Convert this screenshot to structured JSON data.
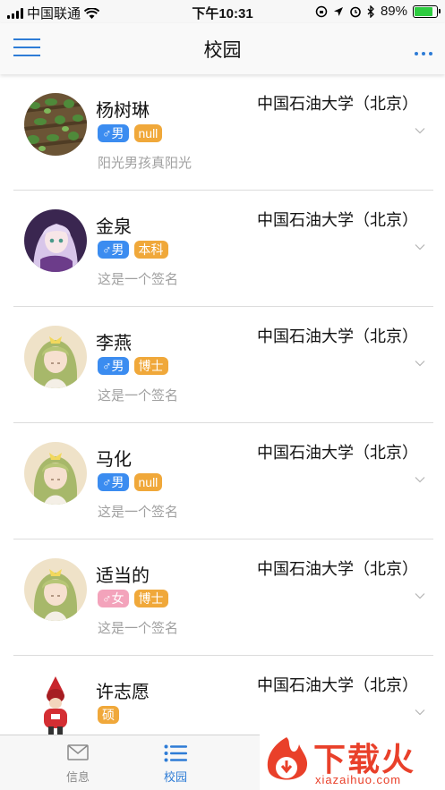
{
  "status_bar": {
    "carrier": "中国联通",
    "time": "下午10:31",
    "battery_text": "89%",
    "battery_level": 0.89
  },
  "nav": {
    "title": "校园"
  },
  "users": [
    {
      "name": "杨树琳",
      "gender": "♂男",
      "gender_type": "male",
      "degree": "null",
      "school": "中国石油大学（北京）",
      "signature": "阳光男孩真阳光",
      "avatar": "plants"
    },
    {
      "name": "金泉",
      "gender": "♂男",
      "gender_type": "male",
      "degree": "本科",
      "school": "中国石油大学（北京）",
      "signature": "这是一个签名",
      "avatar": "anime-purple"
    },
    {
      "name": "李燕",
      "gender": "♂男",
      "gender_type": "male",
      "degree": "博士",
      "school": "中国石油大学（北京）",
      "signature": "这是一个签名",
      "avatar": "doll"
    },
    {
      "name": "马化",
      "gender": "♂男",
      "gender_type": "male",
      "degree": "null",
      "school": "中国石油大学（北京）",
      "signature": "这是一个签名",
      "avatar": "doll"
    },
    {
      "name": "适当的",
      "gender": "♂女",
      "gender_type": "female",
      "degree": "博士",
      "school": "中国石油大学（北京）",
      "signature": "这是一个签名",
      "avatar": "doll"
    },
    {
      "name": "许志愿",
      "gender": "",
      "gender_type": "",
      "degree": "硕",
      "school": "中国石油大学（北京）",
      "signature": "",
      "avatar": "red-figure"
    }
  ],
  "tabs": [
    {
      "label": "信息",
      "icon": "mail-icon",
      "active": false
    },
    {
      "label": "校园",
      "icon": "list-icon",
      "active": true
    }
  ],
  "watermark": {
    "text": "下载火",
    "sub": "xiazaihuo.com"
  },
  "colors": {
    "accent": "#2e7cd6",
    "male_tag": "#3b8cf0",
    "female_tag": "#f3a3bb",
    "degree_tag": "#f0a83a",
    "watermark": "#e9402a"
  }
}
